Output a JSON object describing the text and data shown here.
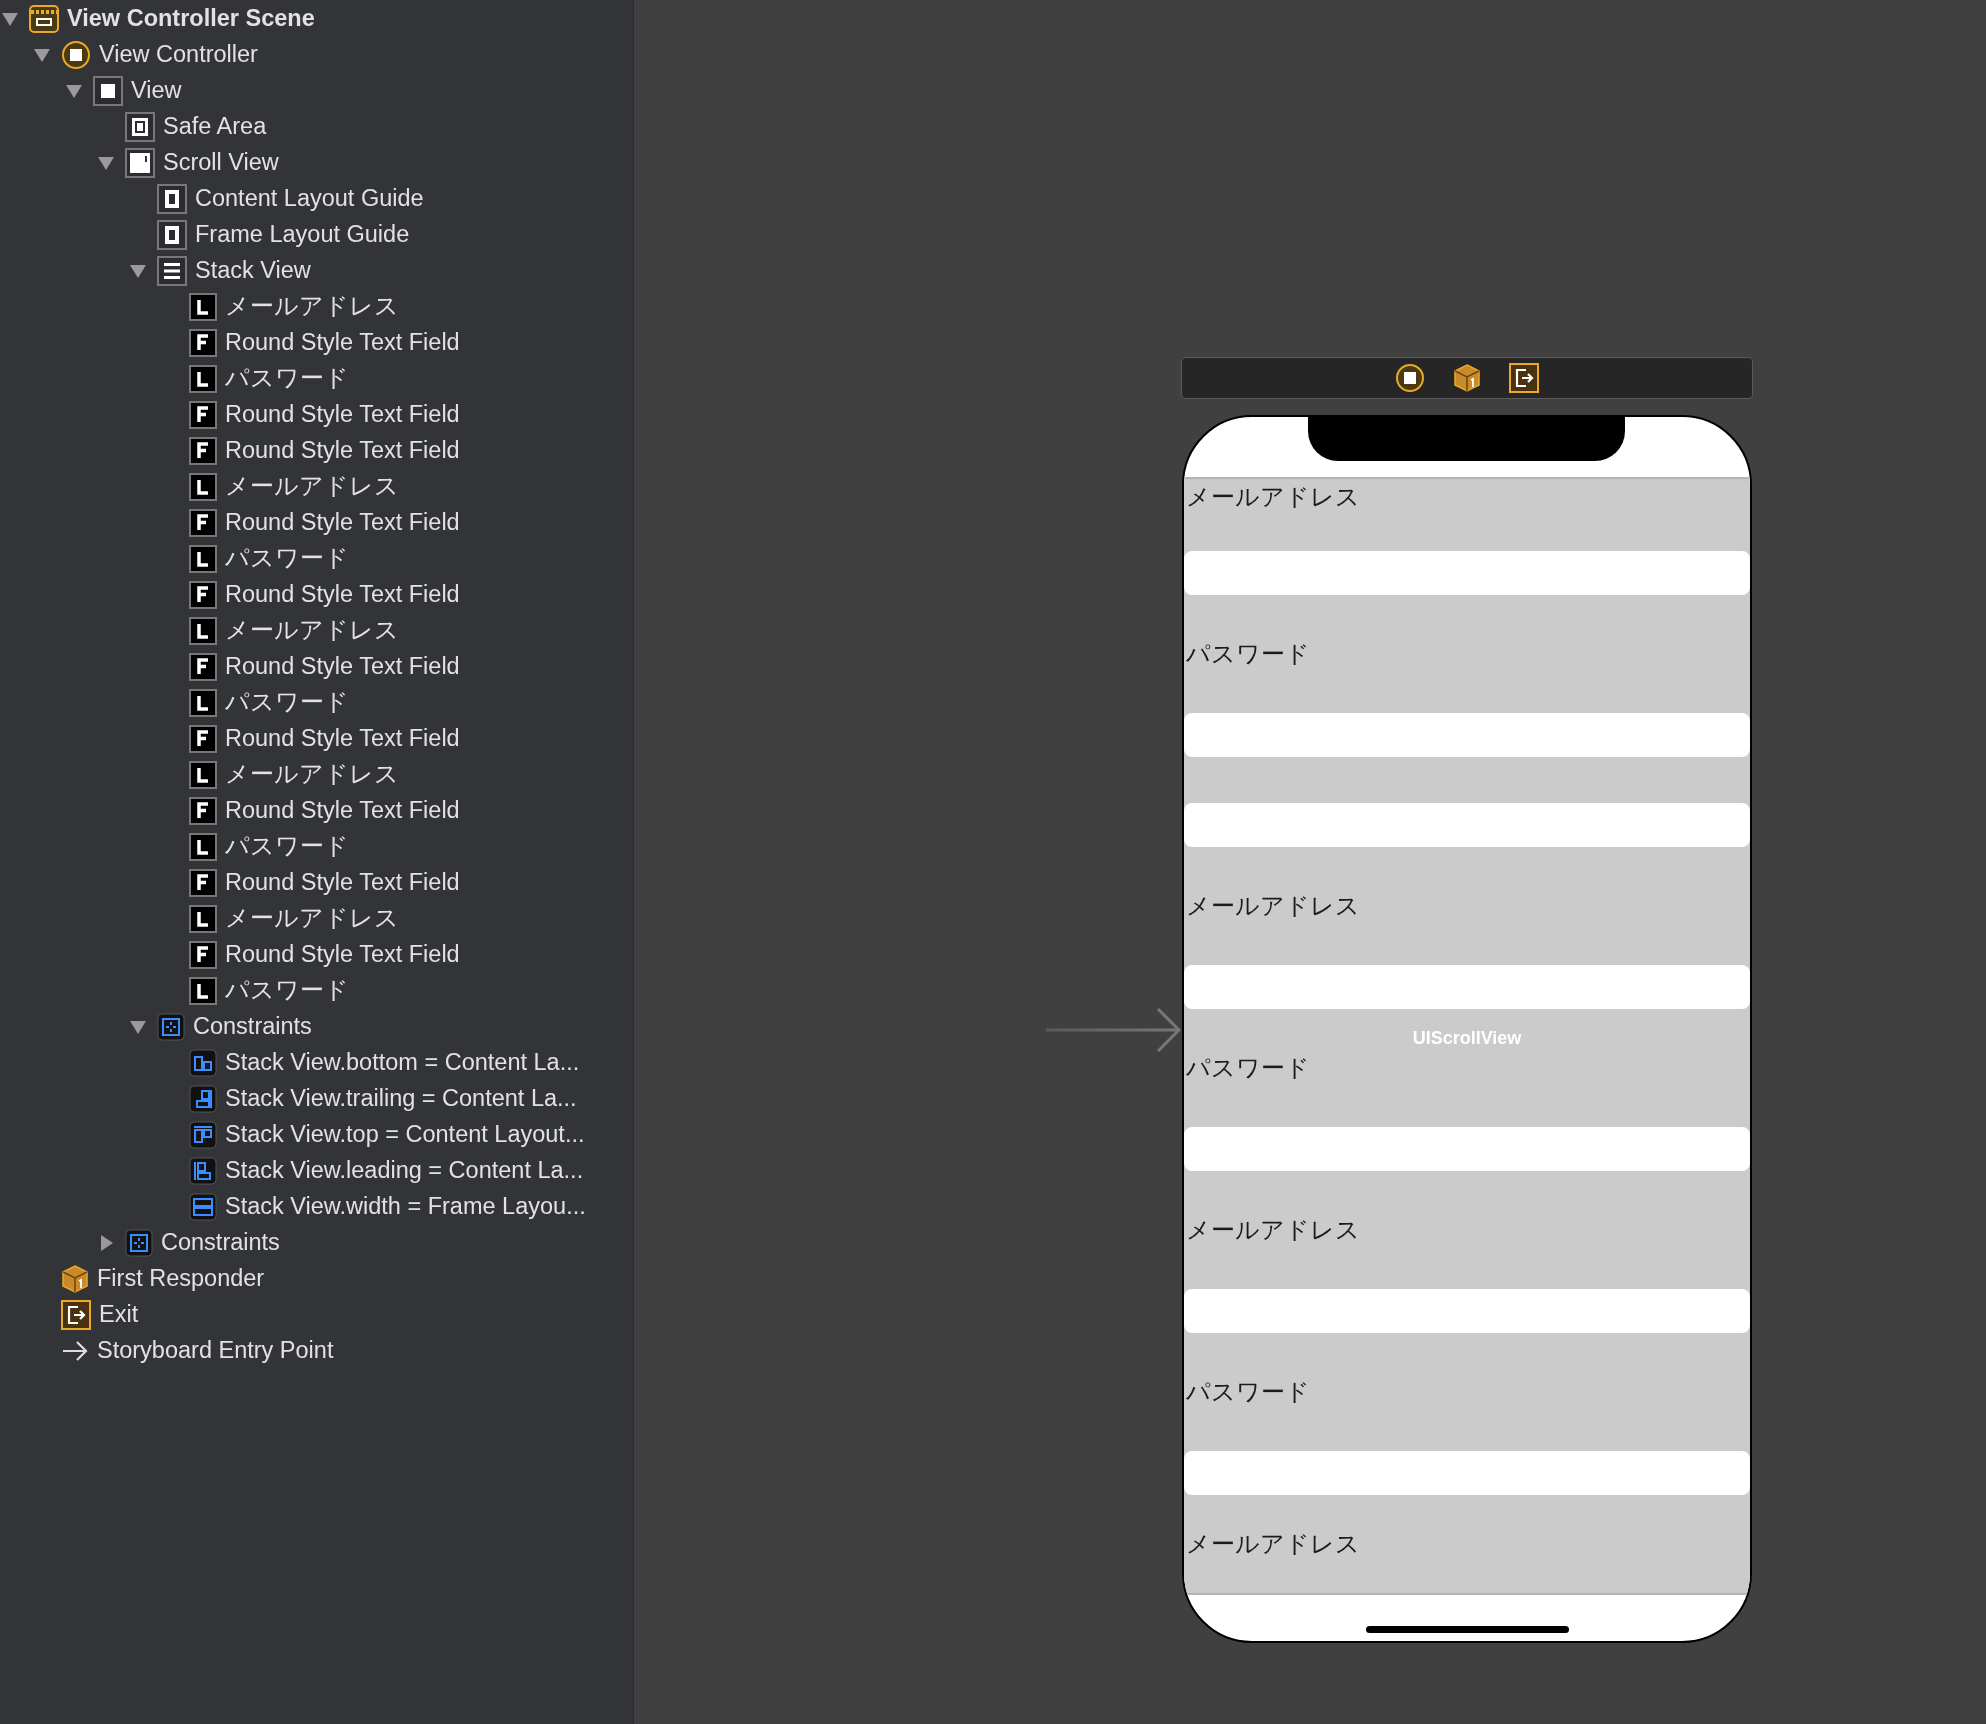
{
  "outline": [
    {
      "kind": "scene",
      "label": "View Controller Scene",
      "expanded": true,
      "children": [
        {
          "kind": "view-controller",
          "label": "View Controller",
          "expanded": true,
          "children": [
            {
              "kind": "view",
              "label": "View",
              "expanded": true,
              "children": [
                {
                  "kind": "safe-area",
                  "label": "Safe Area"
                },
                {
                  "kind": "scroll-view",
                  "label": "Scroll View",
                  "expanded": true,
                  "children": [
                    {
                      "kind": "layout-guide",
                      "label": "Content Layout Guide"
                    },
                    {
                      "kind": "layout-guide",
                      "label": "Frame Layout Guide"
                    },
                    {
                      "kind": "stack-view",
                      "label": "Stack View",
                      "expanded": true,
                      "children": [
                        {
                          "kind": "label",
                          "label": "メールアドレス"
                        },
                        {
                          "kind": "text-field",
                          "label": "Round Style Text Field"
                        },
                        {
                          "kind": "label",
                          "label": "パスワード"
                        },
                        {
                          "kind": "text-field",
                          "label": "Round Style Text Field"
                        },
                        {
                          "kind": "text-field",
                          "label": "Round Style Text Field"
                        },
                        {
                          "kind": "label",
                          "label": "メールアドレス"
                        },
                        {
                          "kind": "text-field",
                          "label": "Round Style Text Field"
                        },
                        {
                          "kind": "label",
                          "label": "パスワード"
                        },
                        {
                          "kind": "text-field",
                          "label": "Round Style Text Field"
                        },
                        {
                          "kind": "label",
                          "label": "メールアドレス"
                        },
                        {
                          "kind": "text-field",
                          "label": "Round Style Text Field"
                        },
                        {
                          "kind": "label",
                          "label": "パスワード"
                        },
                        {
                          "kind": "text-field",
                          "label": "Round Style Text Field"
                        },
                        {
                          "kind": "label",
                          "label": "メールアドレス"
                        },
                        {
                          "kind": "text-field",
                          "label": "Round Style Text Field"
                        },
                        {
                          "kind": "label",
                          "label": "パスワード"
                        },
                        {
                          "kind": "text-field",
                          "label": "Round Style Text Field"
                        },
                        {
                          "kind": "label",
                          "label": "メールアドレス"
                        },
                        {
                          "kind": "text-field",
                          "label": "Round Style Text Field"
                        },
                        {
                          "kind": "label",
                          "label": "パスワード"
                        }
                      ]
                    },
                    {
                      "kind": "constraints",
                      "label": "Constraints",
                      "expanded": true,
                      "children": [
                        {
                          "kind": "constraint-bottom",
                          "label": "Stack View.bottom = Content La..."
                        },
                        {
                          "kind": "constraint-trailing",
                          "label": "Stack View.trailing = Content La..."
                        },
                        {
                          "kind": "constraint-top",
                          "label": "Stack View.top = Content Layout..."
                        },
                        {
                          "kind": "constraint-leading",
                          "label": "Stack View.leading = Content La..."
                        },
                        {
                          "kind": "constraint-width",
                          "label": "Stack View.width = Frame Layou..."
                        }
                      ]
                    }
                  ]
                },
                {
                  "kind": "constraints",
                  "label": "Constraints",
                  "expanded": false
                }
              ]
            }
          ]
        },
        {
          "kind": "first-responder",
          "label": "First Responder"
        },
        {
          "kind": "exit",
          "label": "Exit"
        },
        {
          "kind": "entry-point",
          "label": "Storyboard Entry Point"
        }
      ]
    }
  ],
  "canvas": {
    "scroll_view_label": "UIScrollView",
    "items": [
      {
        "kind": "label",
        "text": "メールアドレス"
      },
      {
        "kind": "field"
      },
      {
        "kind": "label",
        "text": "パスワード"
      },
      {
        "kind": "field"
      },
      {
        "kind": "field"
      },
      {
        "kind": "label",
        "text": "メールアドレス"
      },
      {
        "kind": "field"
      },
      {
        "kind": "label",
        "text": "パスワード"
      },
      {
        "kind": "field"
      },
      {
        "kind": "label",
        "text": "メールアドレス"
      },
      {
        "kind": "field"
      },
      {
        "kind": "label",
        "text": "パスワード"
      },
      {
        "kind": "field"
      },
      {
        "kind": "label",
        "text": "メールアドレス"
      }
    ]
  }
}
